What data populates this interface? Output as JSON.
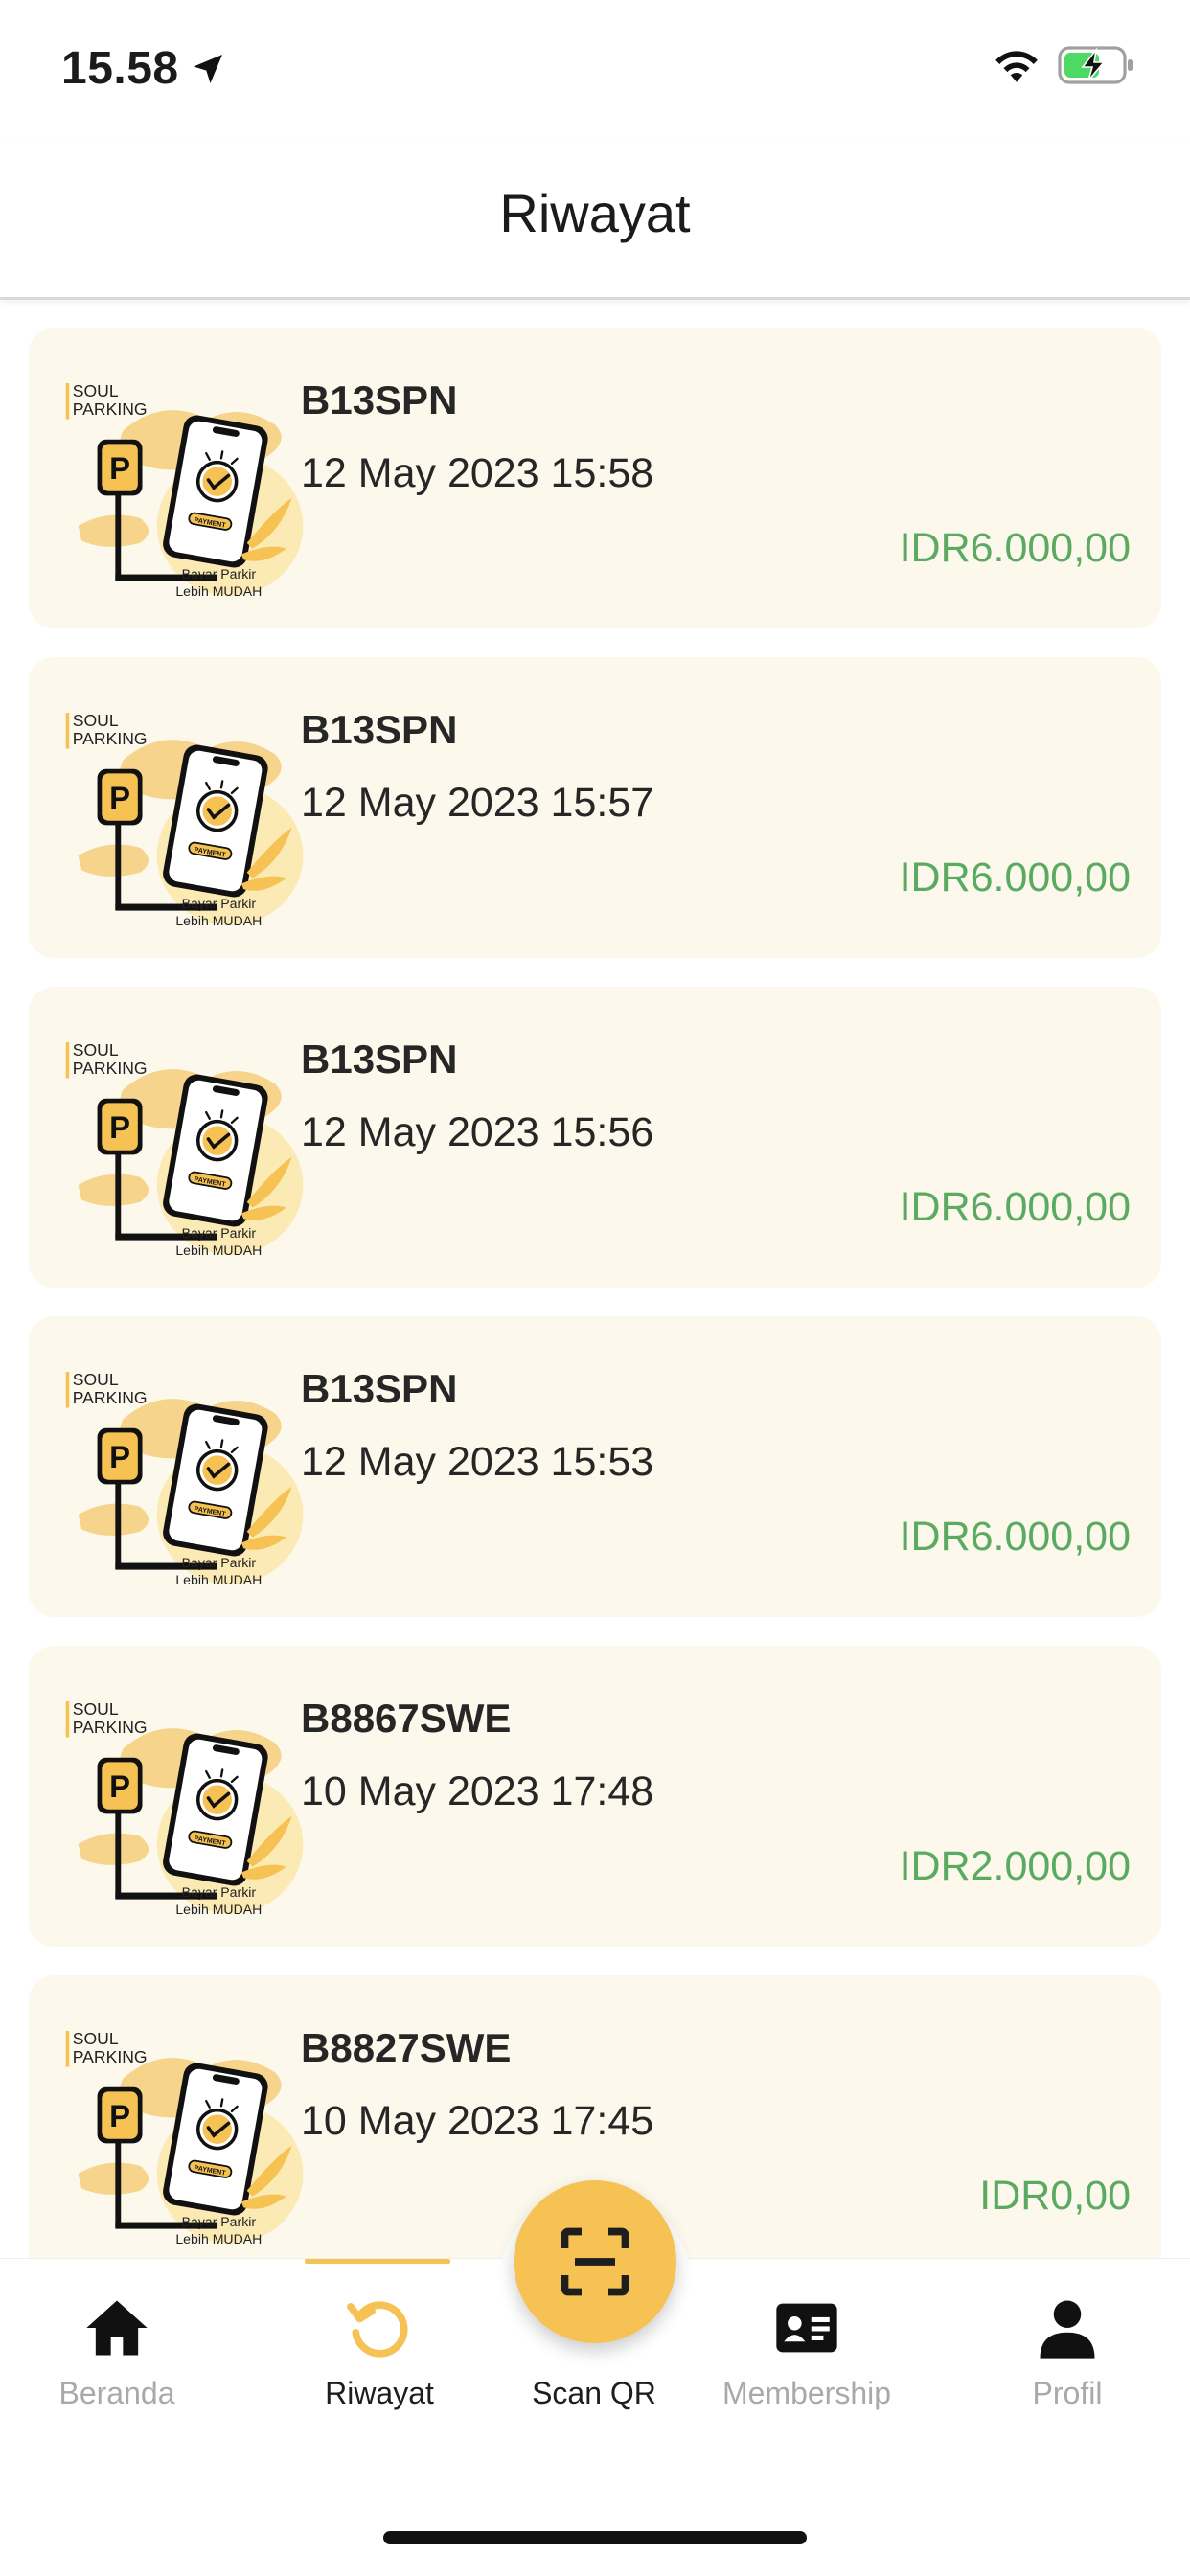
{
  "status_bar": {
    "time": "15.58",
    "icons": [
      "location-arrow-icon",
      "wifi-icon",
      "battery-charging-icon"
    ]
  },
  "header": {
    "title": "Riwayat"
  },
  "thumbnail": {
    "brand_line1": "SOUL",
    "brand_line2": "PARKING",
    "parking_letter": "P",
    "phone_button": "PAYMENT",
    "caption_line1": "Bayar Parkir",
    "caption_line2": "Lebih MUDAH"
  },
  "history": [
    {
      "plate": "B13SPN",
      "datetime": "12 May 2023 15:58",
      "amount": "IDR6.000,00"
    },
    {
      "plate": "B13SPN",
      "datetime": "12 May 2023 15:57",
      "amount": "IDR6.000,00"
    },
    {
      "plate": "B13SPN",
      "datetime": "12 May 2023 15:56",
      "amount": "IDR6.000,00"
    },
    {
      "plate": "B13SPN",
      "datetime": "12 May 2023 15:53",
      "amount": "IDR6.000,00"
    },
    {
      "plate": "B8867SWE",
      "datetime": "10 May 2023 17:48",
      "amount": "IDR2.000,00"
    },
    {
      "plate": "B8827SWE",
      "datetime": "10 May 2023 17:45",
      "amount": "IDR0,00"
    }
  ],
  "nav": {
    "home": "Beranda",
    "history": "Riwayat",
    "scan": "Scan QR",
    "membership": "Membership",
    "profile": "Profil",
    "active": "history"
  },
  "colors": {
    "accent": "#f5c253",
    "card_bg": "#fcf8ec",
    "amount": "#5aaa62",
    "inactive_label": "#a9a9a9"
  }
}
